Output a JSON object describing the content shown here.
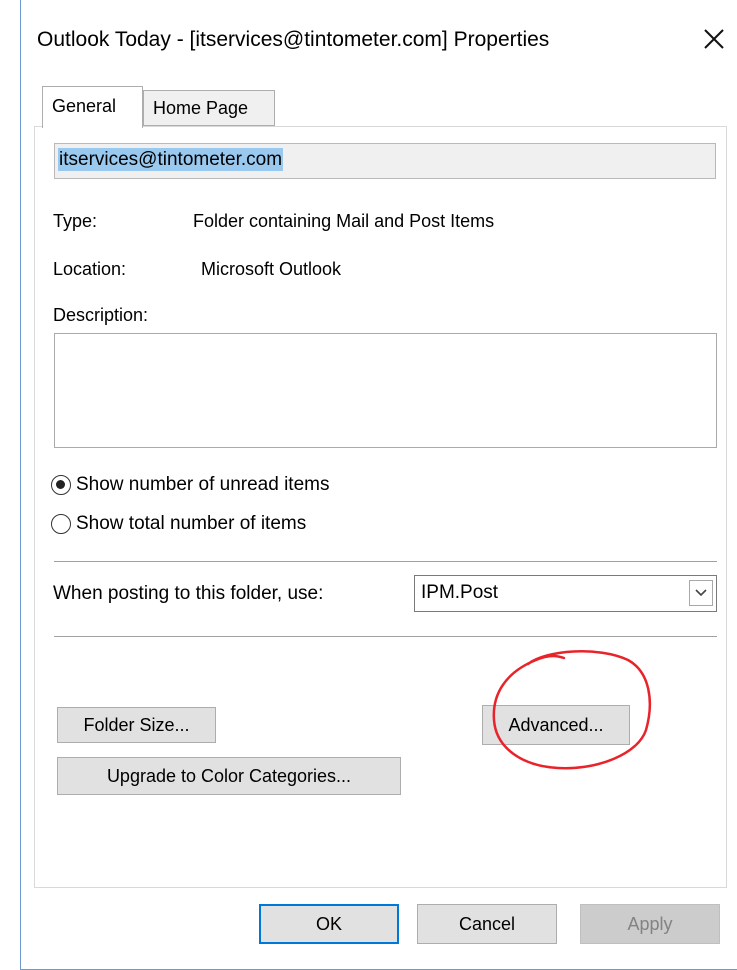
{
  "window": {
    "title": "Outlook Today - [itservices@tintometer.com] Properties",
    "close_icon": "close-icon"
  },
  "tabs": [
    {
      "label": "General",
      "active": true
    },
    {
      "label": "Home Page",
      "active": false
    }
  ],
  "general": {
    "folder_name": "itservices@tintometer.com",
    "type_label": "Type:",
    "type_value": "Folder containing Mail and Post Items",
    "location_label": "Location:",
    "location_value": "Microsoft Outlook",
    "description_label": "Description:",
    "description_value": "",
    "radio_options": [
      {
        "label": "Show number of unread items",
        "checked": true
      },
      {
        "label": "Show total number of items",
        "checked": false
      }
    ],
    "posting_label": "When posting to this folder, use:",
    "posting_value": "IPM.Post",
    "folder_size_button": "Folder Size...",
    "upgrade_button": "Upgrade to Color Categories...",
    "advanced_button": "Advanced..."
  },
  "footer": {
    "ok_button": "OK",
    "cancel_button": "Cancel",
    "apply_button": "Apply"
  },
  "colors": {
    "selection_highlight": "#99c9ef",
    "annotation_circle": "#e8232a",
    "window_border": "#6d9bd1",
    "default_button_border": "#0078d7"
  }
}
